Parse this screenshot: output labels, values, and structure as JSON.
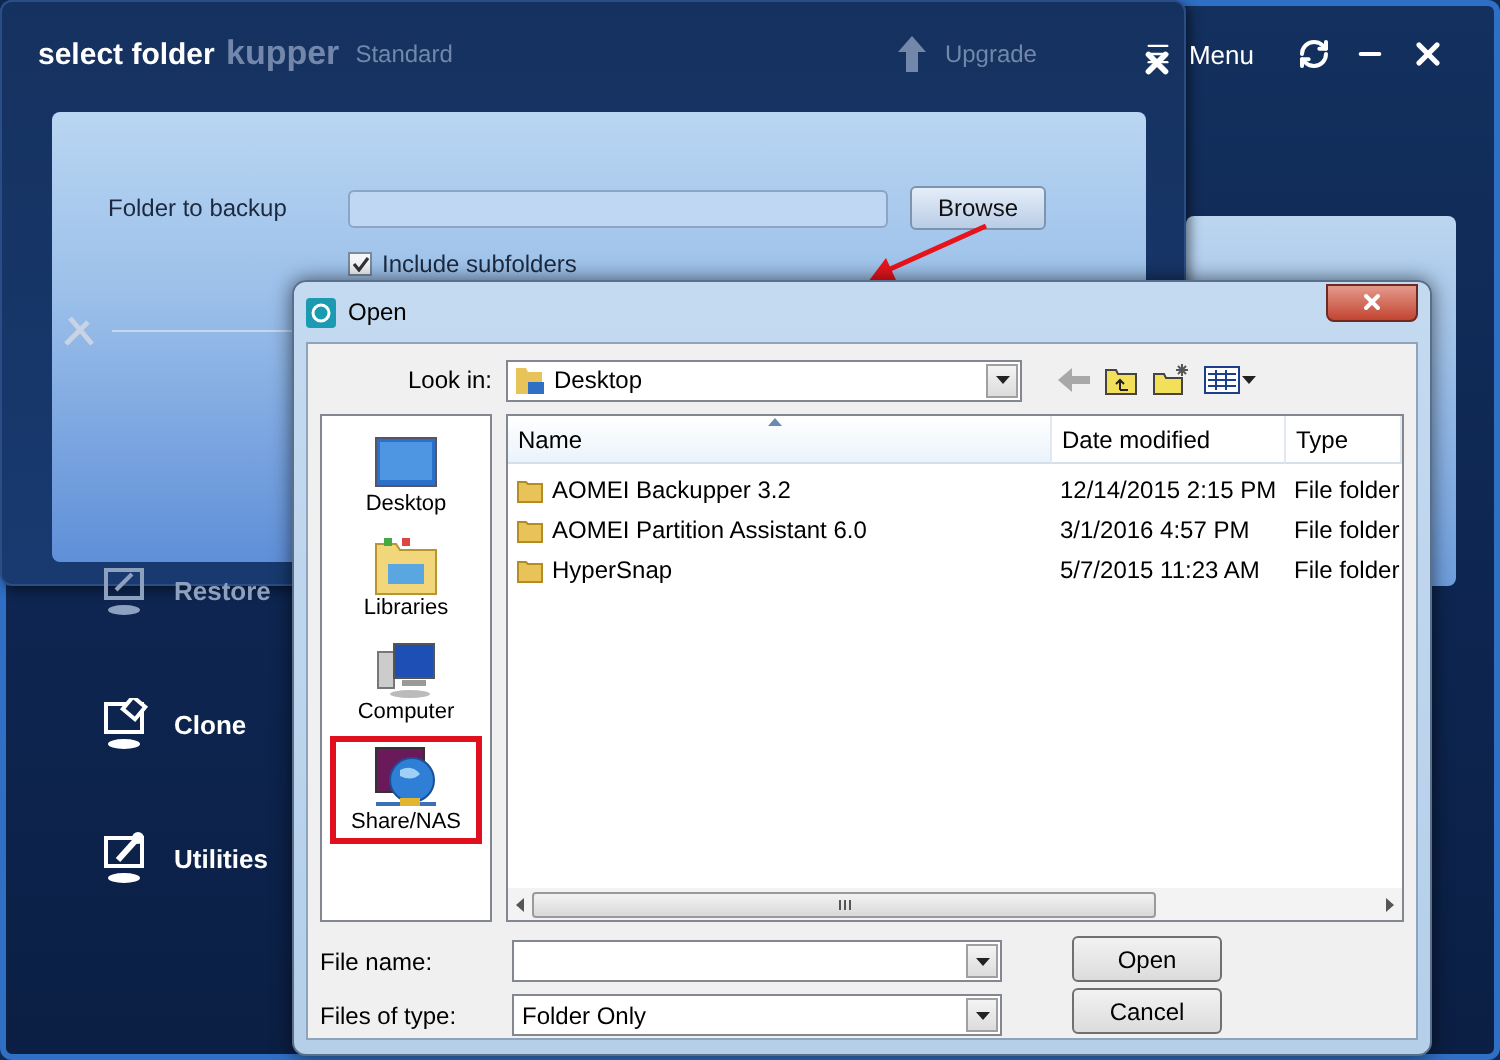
{
  "app": {
    "title_fragment": "kupper",
    "edition": "Standard",
    "upgrade": "Upgrade",
    "menu": "Menu",
    "nav": [
      {
        "label": "Restore",
        "kind": "restore",
        "dimmed": true
      },
      {
        "label": "Clone",
        "kind": "clone",
        "dimmed": false
      },
      {
        "label": "Utilities",
        "kind": "utilities",
        "dimmed": false
      }
    ]
  },
  "select_folder": {
    "title": "select folder",
    "field_label": "Folder to backup",
    "browse": "Browse",
    "include_subfolders": {
      "label": "Include subfolders",
      "checked": true
    }
  },
  "open_dialog": {
    "title": "Open",
    "look_in_label": "Look in:",
    "look_in": "Desktop",
    "places": [
      {
        "label": "Desktop",
        "kind": "desktop",
        "highlighted": false
      },
      {
        "label": "Libraries",
        "kind": "libraries",
        "highlighted": false
      },
      {
        "label": "Computer",
        "kind": "computer",
        "highlighted": false
      },
      {
        "label": "Share/NAS",
        "kind": "network",
        "highlighted": true
      }
    ],
    "columns": [
      {
        "label": "Name",
        "sorted": true
      },
      {
        "label": "Date modified",
        "sorted": false
      },
      {
        "label": "Type",
        "sorted": false
      }
    ],
    "rows": [
      {
        "name": "AOMEI Backupper 3.2",
        "date": "12/14/2015 2:15 PM",
        "type": "File folder"
      },
      {
        "name": "AOMEI Partition Assistant 6.0",
        "date": "3/1/2016 4:57 PM",
        "type": "File folder"
      },
      {
        "name": "HyperSnap",
        "date": "5/7/2015 11:23 AM",
        "type": "File folder"
      }
    ],
    "file_name_label": "File name:",
    "files_of_type_label": "Files of type:",
    "files_of_type": "Folder Only",
    "buttons": [
      "Open",
      "Cancel"
    ]
  }
}
